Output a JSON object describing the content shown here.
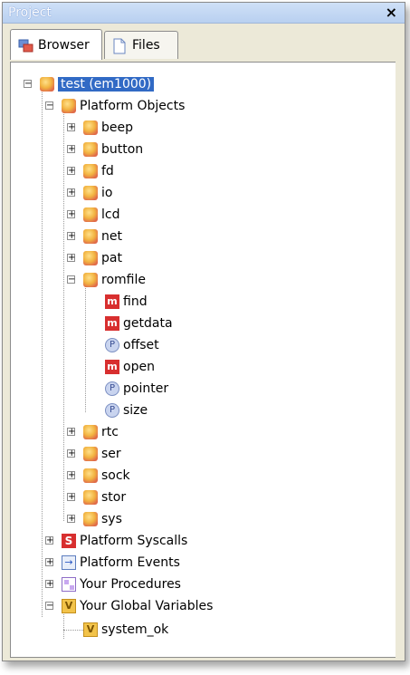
{
  "window": {
    "title": "Project",
    "close_glyph": "×"
  },
  "tabs": [
    {
      "label": "Browser",
      "icon": "browser-icon",
      "active": true
    },
    {
      "label": "Files",
      "icon": "file-icon",
      "active": false
    }
  ],
  "tree": {
    "root": {
      "label": "test (em1000)",
      "expanded": true,
      "selected": true
    },
    "platform_objects": {
      "label": "Platform Objects",
      "items_before": [
        "beep",
        "button",
        "fd",
        "io",
        "lcd",
        "net",
        "pat"
      ],
      "romfile": {
        "label": "romfile",
        "children": [
          {
            "label": "find",
            "kind": "m"
          },
          {
            "label": "getdata",
            "kind": "m"
          },
          {
            "label": "offset",
            "kind": "p"
          },
          {
            "label": "open",
            "kind": "m"
          },
          {
            "label": "pointer",
            "kind": "p"
          },
          {
            "label": "size",
            "kind": "p"
          }
        ]
      },
      "items_after": [
        "rtc",
        "ser",
        "sock",
        "stor",
        "sys"
      ]
    },
    "platform_syscalls": {
      "label": "Platform Syscalls"
    },
    "platform_events": {
      "label": "Platform Events"
    },
    "your_procedures": {
      "label": "Your Procedures"
    },
    "your_global_variables": {
      "label": "Your Global Variables",
      "children": [
        {
          "label": "system_ok",
          "kind": "v"
        }
      ]
    }
  },
  "icon_glyphs": {
    "m": "m",
    "p": "P",
    "s": "S",
    "v": "V",
    "e": "→"
  },
  "colors": {
    "selection": "#316ac5",
    "titlebar": "#b9d0f0"
  }
}
